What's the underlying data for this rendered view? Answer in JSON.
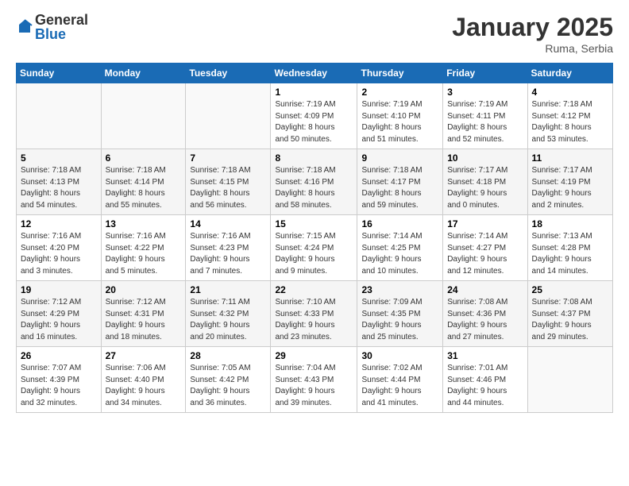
{
  "logo": {
    "general": "General",
    "blue": "Blue"
  },
  "header": {
    "month": "January 2025",
    "location": "Ruma, Serbia"
  },
  "weekdays": [
    "Sunday",
    "Monday",
    "Tuesday",
    "Wednesday",
    "Thursday",
    "Friday",
    "Saturday"
  ],
  "weeks": [
    [
      {
        "day": "",
        "info": ""
      },
      {
        "day": "",
        "info": ""
      },
      {
        "day": "",
        "info": ""
      },
      {
        "day": "1",
        "info": "Sunrise: 7:19 AM\nSunset: 4:09 PM\nDaylight: 8 hours\nand 50 minutes."
      },
      {
        "day": "2",
        "info": "Sunrise: 7:19 AM\nSunset: 4:10 PM\nDaylight: 8 hours\nand 51 minutes."
      },
      {
        "day": "3",
        "info": "Sunrise: 7:19 AM\nSunset: 4:11 PM\nDaylight: 8 hours\nand 52 minutes."
      },
      {
        "day": "4",
        "info": "Sunrise: 7:18 AM\nSunset: 4:12 PM\nDaylight: 8 hours\nand 53 minutes."
      }
    ],
    [
      {
        "day": "5",
        "info": "Sunrise: 7:18 AM\nSunset: 4:13 PM\nDaylight: 8 hours\nand 54 minutes."
      },
      {
        "day": "6",
        "info": "Sunrise: 7:18 AM\nSunset: 4:14 PM\nDaylight: 8 hours\nand 55 minutes."
      },
      {
        "day": "7",
        "info": "Sunrise: 7:18 AM\nSunset: 4:15 PM\nDaylight: 8 hours\nand 56 minutes."
      },
      {
        "day": "8",
        "info": "Sunrise: 7:18 AM\nSunset: 4:16 PM\nDaylight: 8 hours\nand 58 minutes."
      },
      {
        "day": "9",
        "info": "Sunrise: 7:18 AM\nSunset: 4:17 PM\nDaylight: 8 hours\nand 59 minutes."
      },
      {
        "day": "10",
        "info": "Sunrise: 7:17 AM\nSunset: 4:18 PM\nDaylight: 9 hours\nand 0 minutes."
      },
      {
        "day": "11",
        "info": "Sunrise: 7:17 AM\nSunset: 4:19 PM\nDaylight: 9 hours\nand 2 minutes."
      }
    ],
    [
      {
        "day": "12",
        "info": "Sunrise: 7:16 AM\nSunset: 4:20 PM\nDaylight: 9 hours\nand 3 minutes."
      },
      {
        "day": "13",
        "info": "Sunrise: 7:16 AM\nSunset: 4:22 PM\nDaylight: 9 hours\nand 5 minutes."
      },
      {
        "day": "14",
        "info": "Sunrise: 7:16 AM\nSunset: 4:23 PM\nDaylight: 9 hours\nand 7 minutes."
      },
      {
        "day": "15",
        "info": "Sunrise: 7:15 AM\nSunset: 4:24 PM\nDaylight: 9 hours\nand 9 minutes."
      },
      {
        "day": "16",
        "info": "Sunrise: 7:14 AM\nSunset: 4:25 PM\nDaylight: 9 hours\nand 10 minutes."
      },
      {
        "day": "17",
        "info": "Sunrise: 7:14 AM\nSunset: 4:27 PM\nDaylight: 9 hours\nand 12 minutes."
      },
      {
        "day": "18",
        "info": "Sunrise: 7:13 AM\nSunset: 4:28 PM\nDaylight: 9 hours\nand 14 minutes."
      }
    ],
    [
      {
        "day": "19",
        "info": "Sunrise: 7:12 AM\nSunset: 4:29 PM\nDaylight: 9 hours\nand 16 minutes."
      },
      {
        "day": "20",
        "info": "Sunrise: 7:12 AM\nSunset: 4:31 PM\nDaylight: 9 hours\nand 18 minutes."
      },
      {
        "day": "21",
        "info": "Sunrise: 7:11 AM\nSunset: 4:32 PM\nDaylight: 9 hours\nand 20 minutes."
      },
      {
        "day": "22",
        "info": "Sunrise: 7:10 AM\nSunset: 4:33 PM\nDaylight: 9 hours\nand 23 minutes."
      },
      {
        "day": "23",
        "info": "Sunrise: 7:09 AM\nSunset: 4:35 PM\nDaylight: 9 hours\nand 25 minutes."
      },
      {
        "day": "24",
        "info": "Sunrise: 7:08 AM\nSunset: 4:36 PM\nDaylight: 9 hours\nand 27 minutes."
      },
      {
        "day": "25",
        "info": "Sunrise: 7:08 AM\nSunset: 4:37 PM\nDaylight: 9 hours\nand 29 minutes."
      }
    ],
    [
      {
        "day": "26",
        "info": "Sunrise: 7:07 AM\nSunset: 4:39 PM\nDaylight: 9 hours\nand 32 minutes."
      },
      {
        "day": "27",
        "info": "Sunrise: 7:06 AM\nSunset: 4:40 PM\nDaylight: 9 hours\nand 34 minutes."
      },
      {
        "day": "28",
        "info": "Sunrise: 7:05 AM\nSunset: 4:42 PM\nDaylight: 9 hours\nand 36 minutes."
      },
      {
        "day": "29",
        "info": "Sunrise: 7:04 AM\nSunset: 4:43 PM\nDaylight: 9 hours\nand 39 minutes."
      },
      {
        "day": "30",
        "info": "Sunrise: 7:02 AM\nSunset: 4:44 PM\nDaylight: 9 hours\nand 41 minutes."
      },
      {
        "day": "31",
        "info": "Sunrise: 7:01 AM\nSunset: 4:46 PM\nDaylight: 9 hours\nand 44 minutes."
      },
      {
        "day": "",
        "info": ""
      }
    ]
  ]
}
